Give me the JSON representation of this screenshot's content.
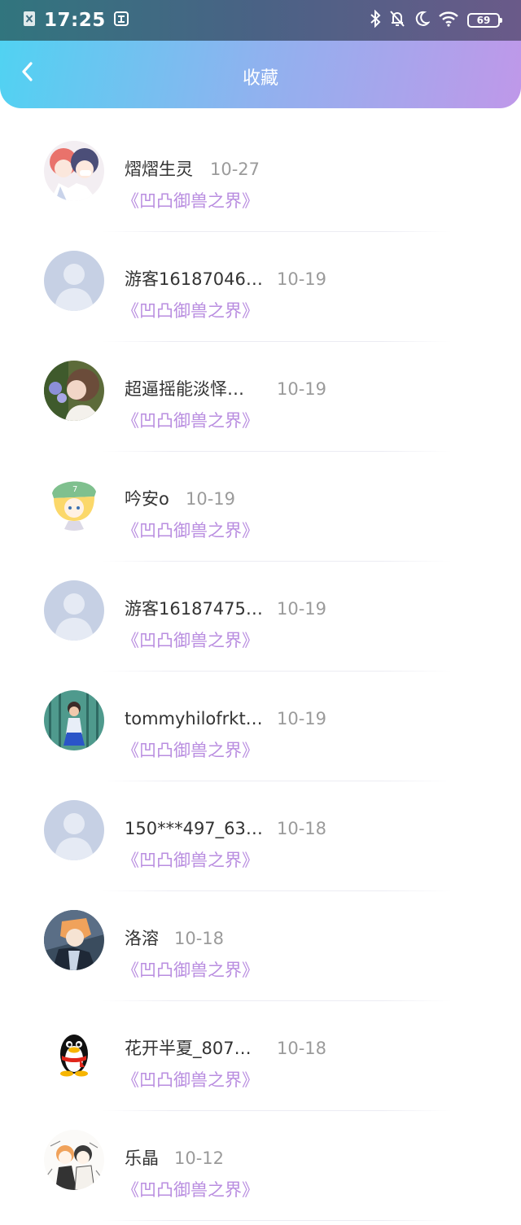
{
  "status_bar": {
    "time": "17:25",
    "battery": "69",
    "left_icons": [
      "close-box-icon",
      "sim-icon"
    ],
    "right_icons": [
      "bluetooth-icon",
      "mute-bell-icon",
      "moon-icon",
      "wifi-icon",
      "battery-icon"
    ]
  },
  "nav": {
    "title": "收藏",
    "back_icon": "chevron-left-icon"
  },
  "colors": {
    "header_gradient": [
      "#4fd3f2",
      "#bf98e9"
    ],
    "book_title": "#b98de0",
    "date": "#9b9b9b",
    "username": "#333333"
  },
  "items": [
    {
      "user": "熠熠生灵",
      "date": "10-27",
      "book": "《凹凸御兽之界》",
      "avatar": "anime-duo-avatar"
    },
    {
      "user": "游客16187046…",
      "date": "10-19",
      "book": "《凹凸御兽之界》",
      "avatar": "default-avatar"
    },
    {
      "user": "超逼摇能淡怿…",
      "date": "10-19",
      "book": "《凹凸御兽之界》",
      "avatar": "photo-girl-avatar"
    },
    {
      "user": "吟安o",
      "date": "10-19",
      "book": "《凹凸御兽之界》",
      "avatar": "anime-green-hat-avatar"
    },
    {
      "user": "游客16187475…",
      "date": "10-19",
      "book": "《凹凸御兽之界》",
      "avatar": "default-avatar"
    },
    {
      "user": "tommyhilofrkt…",
      "date": "10-19",
      "book": "《凹凸御兽之界》",
      "avatar": "photo-child-avatar"
    },
    {
      "user": "150***497_63…",
      "date": "10-18",
      "book": "《凹凸御兽之界》",
      "avatar": "default-avatar"
    },
    {
      "user": "洛溶",
      "date": "10-18",
      "book": "《凹凸御兽之界》",
      "avatar": "anime-dark-avatar"
    },
    {
      "user": "花开半夏_807…",
      "date": "10-18",
      "book": "《凹凸御兽之界》",
      "avatar": "qq-penguin-avatar"
    },
    {
      "user": "乐晶",
      "date": "10-12",
      "book": "《凹凸御兽之界》",
      "avatar": "anime-sketch-avatar"
    }
  ]
}
